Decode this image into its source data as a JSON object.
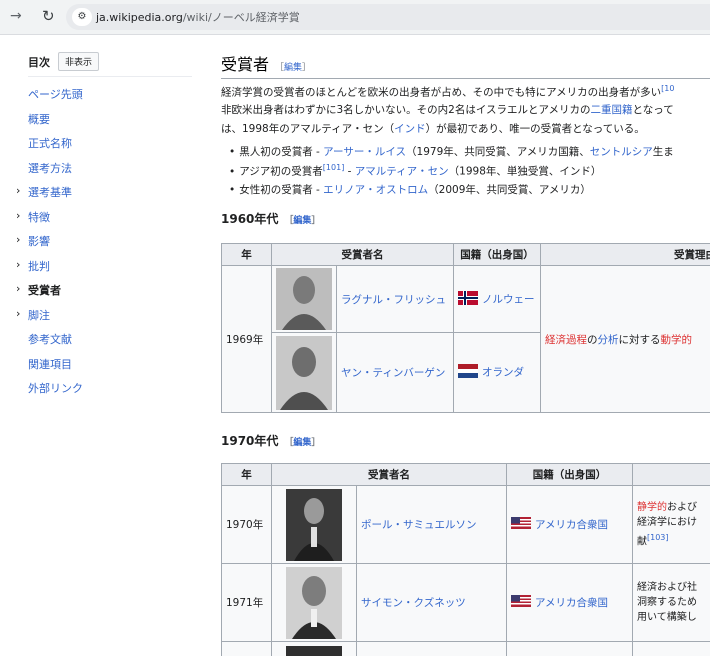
{
  "browser": {
    "url_host": "ja.wikipedia.org",
    "url_path": "/wiki/ノーベル経済学賞"
  },
  "toc": {
    "heading": "目次",
    "hide_button": "非表示",
    "items": [
      {
        "label": "ページ先頭",
        "chevron": false,
        "active": false
      },
      {
        "label": "概要",
        "chevron": false,
        "active": false
      },
      {
        "label": "正式名称",
        "chevron": false,
        "active": false
      },
      {
        "label": "選考方法",
        "chevron": false,
        "active": false
      },
      {
        "label": "選考基準",
        "chevron": true,
        "active": false
      },
      {
        "label": "特徴",
        "chevron": true,
        "active": false
      },
      {
        "label": "影響",
        "chevron": true,
        "active": false
      },
      {
        "label": "批判",
        "chevron": true,
        "active": false
      },
      {
        "label": "受賞者",
        "chevron": true,
        "active": true
      },
      {
        "label": "脚注",
        "chevron": true,
        "active": false
      },
      {
        "label": "参考文献",
        "chevron": false,
        "active": false
      },
      {
        "label": "関連項目",
        "chevron": false,
        "active": false
      },
      {
        "label": "外部リンク",
        "chevron": false,
        "active": false
      }
    ]
  },
  "section": {
    "title": "受賞者",
    "edit_open": "［",
    "edit_label": "編集",
    "edit_close": "］",
    "para1_text": "経済学賞の受賞者のほとんどを欧米の出身者が占め、その中でも特にアメリカの出身者が多い",
    "para1_ref": "[10",
    "para2_text": "非欧米出身者はわずかに3名しかいない。その内2名はイスラエルとアメリカの",
    "para2_link": "二重国籍",
    "para2_tail": "となって",
    "para3_pre": "は、1998年のアマルティア・セン（",
    "para3_link": "インド",
    "para3_post": "）が最初であり、唯一の受賞者となっている。",
    "bullets": [
      {
        "pre": "黒人初の受賞者 - ",
        "link": "アーサー・ルイス",
        "mid": "（1979年、共同受賞、アメリカ国籍、",
        "link2": "セントルシア",
        "post": "生ま",
        "ref": ""
      },
      {
        "pre": "アジア初の受賞者",
        "ref": "[101]",
        "mid_pre": " - ",
        "link": "アマルティア・セン",
        "post": "（1998年、単独受賞、インド）"
      },
      {
        "pre": "女性初の受賞者 - ",
        "link": "エリノア・オストロム",
        "post": "（2009年、共同受賞、アメリカ）"
      }
    ]
  },
  "sub1960": {
    "title": "1960年代",
    "edit_label": "編集",
    "headers": [
      "年",
      "受賞者名",
      "国籍（出身国）",
      "受賞理由"
    ],
    "year": "1969年",
    "reason_link1": "経済過程",
    "reason_mid": "の",
    "reason_link2": "分析",
    "reason_mid2": "に対する",
    "reason_link3": "動学的",
    "rows": [
      {
        "name": "ラグナル・フリッシュ",
        "country": "ノルウェー",
        "flag": "norway-flag-icon"
      },
      {
        "name": "ヤン・ティンバーゲン",
        "country": "オランダ",
        "flag": "netherlands-flag-icon"
      }
    ]
  },
  "sub1970": {
    "title": "1970年代",
    "edit_label": "編集",
    "headers": [
      "年",
      "受賞者名",
      "国籍（出身国）",
      ""
    ],
    "rows": [
      {
        "year": "1970年",
        "name": "ポール・サミュエルソン",
        "country": "アメリカ合衆国",
        "reason_link": "静学的",
        "reason_l1": "および",
        "reason_l2": "経済学におけ",
        "reason_l3": "献",
        "reason_ref": "[103]"
      },
      {
        "year": "1971年",
        "name": "サイモン・クズネッツ",
        "country": "アメリカ合衆国",
        "reason_l1": "経済および社",
        "reason_l2": "洞察するため",
        "reason_l3": "用いて構築し"
      }
    ]
  },
  "colors": {
    "link": "#3366cc",
    "redlink": "#d33",
    "header_bg": "#eaecf0",
    "cell_bg": "#f8f9fa",
    "border": "#a2a9b1"
  }
}
